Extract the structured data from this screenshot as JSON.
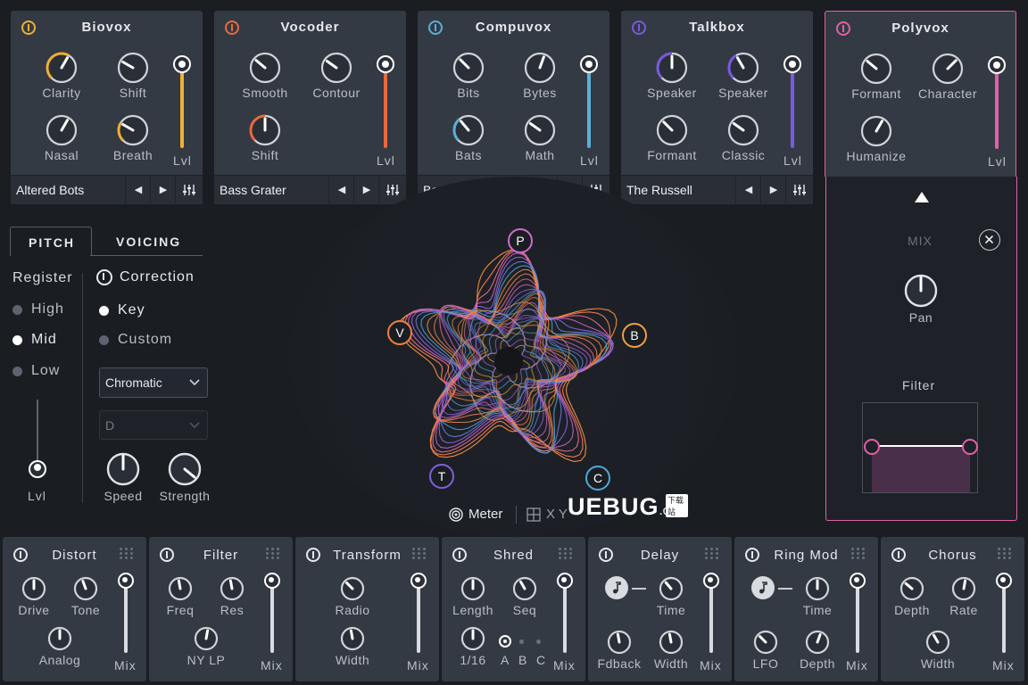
{
  "modules": [
    {
      "title": "Biovox",
      "color": "#f0b030",
      "knobs": [
        "Clarity",
        "Shift",
        "Nasal",
        "Breath"
      ],
      "level": "Lvl",
      "preset": "Altered Bots"
    },
    {
      "title": "Vocoder",
      "color": "#e86a3c",
      "knobs": [
        "Smooth",
        "Contour",
        "Shift"
      ],
      "level": "Lvl",
      "preset": "Bass Grater"
    },
    {
      "title": "Compuvox",
      "color": "#5ab0d8",
      "knobs": [
        "Bits",
        "Bytes",
        "Bats",
        "Math"
      ],
      "level": "Lvl",
      "preset": "Basic Syntax"
    },
    {
      "title": "Talkbox",
      "color": "#7a5ae0",
      "knobs": [
        "Speaker",
        "Speaker",
        "Formant",
        "Classic"
      ],
      "level": "Lvl",
      "preset": "The Russell"
    },
    {
      "title": "Polyvox",
      "color": "#e060a8",
      "knobs": [
        "Formant",
        "Character",
        "Humanize"
      ],
      "level": "Lvl"
    }
  ],
  "preset_controls": {
    "prev": "◀",
    "next": "▶"
  },
  "tabs": {
    "pitch": "PITCH",
    "voicing": "VOICING"
  },
  "pitch": {
    "register_label": "Register",
    "registers": [
      "High",
      "Mid",
      "Low"
    ],
    "selected_register": "Mid",
    "level": "Lvl",
    "correction_label": "Correction",
    "modes": [
      "Key",
      "Custom"
    ],
    "selected_mode": "Key",
    "scale": "Chromatic",
    "key": "D",
    "knobs": [
      "Speed",
      "Strength"
    ]
  },
  "center": {
    "nodes": [
      "P",
      "B",
      "C",
      "T",
      "V"
    ],
    "meter": "Meter",
    "xy": "X Y"
  },
  "polyvox_side": {
    "mix": "MIX",
    "pan": "Pan",
    "filter": "Filter"
  },
  "fx": [
    {
      "title": "Distort",
      "knobs": [
        "Drive",
        "Tone",
        "Analog"
      ],
      "mix": "Mix"
    },
    {
      "title": "Filter",
      "knobs": [
        "Freq",
        "Res",
        "NY LP"
      ],
      "mix": "Mix"
    },
    {
      "title": "Transform",
      "knobs": [
        "Radio",
        "Width"
      ],
      "mix": "Mix"
    },
    {
      "title": "Shred",
      "knobs": [
        "Length",
        "Seq",
        "1/16"
      ],
      "abc": [
        "A",
        "B",
        "C"
      ],
      "mix": "Mix"
    },
    {
      "title": "Delay",
      "knobs": [
        "Time",
        "Fdback",
        "Width"
      ],
      "mix": "Mix"
    },
    {
      "title": "Ring Mod",
      "knobs": [
        "Time",
        "LFO",
        "Depth"
      ],
      "mix": "Mix"
    },
    {
      "title": "Chorus",
      "knobs": [
        "Depth",
        "Rate",
        "Width"
      ],
      "mix": "Mix"
    }
  ],
  "watermark": {
    "brand": "UEBUG",
    "tld": ".com",
    "tag": "下载站"
  }
}
